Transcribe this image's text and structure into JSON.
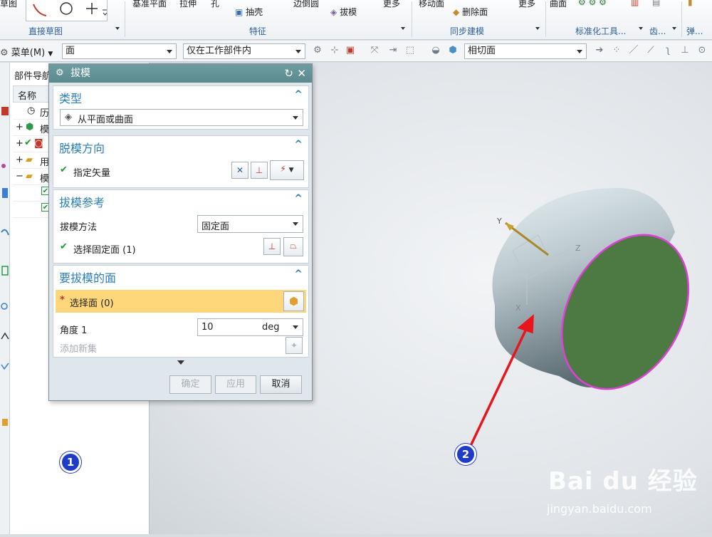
{
  "ribbon": {
    "top_texts": [
      "草图",
      "基准平面",
      "拉伸",
      "孔",
      "边倒圆",
      "更多",
      "移动面",
      "更多",
      "曲面"
    ],
    "items": [
      {
        "label": "抽壳",
        "icon": "shell-icon"
      },
      {
        "label": "拔模",
        "icon": "draft-icon"
      },
      {
        "label": "删除面",
        "icon": "delete-face-icon"
      }
    ],
    "groups": [
      "直接草图",
      "特征",
      "同步建模",
      "标准化工具...",
      "齿...",
      "弹..."
    ]
  },
  "toolbar": {
    "menu_label": "菜单(M)",
    "filter_value": "面",
    "scope_value": "仅在工作部件内",
    "rule_value": "相切面"
  },
  "navigator": {
    "title": "部件导航",
    "column_name": "名称",
    "rows": [
      "历",
      "模",
      "",
      "用",
      "模"
    ]
  },
  "dialog": {
    "title": "拔模",
    "type": {
      "header": "类型",
      "value": "从平面或曲面"
    },
    "direction": {
      "header": "脱模方向",
      "label": "指定矢量"
    },
    "reference": {
      "header": "拔模参考",
      "method_label": "拔模方法",
      "method_value": "固定面",
      "fixed_face_label": "选择固定面 (1)"
    },
    "faces": {
      "header": "要拔模的面",
      "select_label": "选择面 (0)",
      "required_mark": "*",
      "angle_label": "角度 1",
      "angle_value": "10",
      "angle_unit": "deg",
      "add_new": "添加新集"
    },
    "buttons": {
      "ok": "确定",
      "apply": "应用",
      "cancel": "取消"
    }
  },
  "viewport": {
    "axis_labels": [
      "Y",
      "Z",
      "X"
    ]
  },
  "annotations": {
    "badge1": "1",
    "badge2": "2",
    "arrow_color": "#e8161c"
  },
  "watermark": {
    "text": "Bai du 经验",
    "url": "jingyan.baidu.com"
  },
  "colors": {
    "title_bar": "#5f8f93",
    "section_header": "#2b7fb5",
    "highlight_row": "#fdd77a",
    "end_face": "#4d7a43",
    "edge_highlight": "#e040d8"
  }
}
